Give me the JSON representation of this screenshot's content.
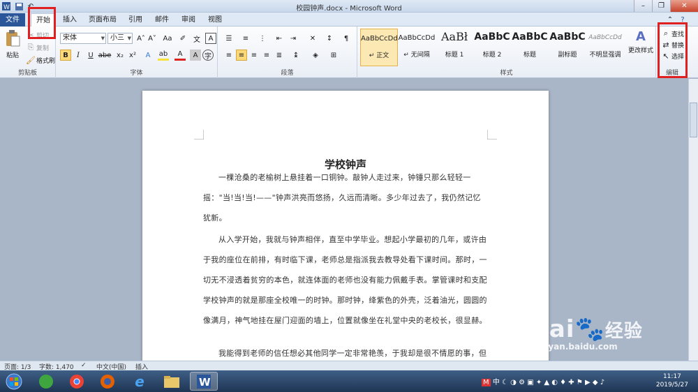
{
  "window": {
    "title": "校园钟声.docx - Microsoft Word"
  },
  "tabs": [
    {
      "label": "文件"
    },
    {
      "label": "开始"
    },
    {
      "label": "插入"
    },
    {
      "label": "页面布局"
    },
    {
      "label": "引用"
    },
    {
      "label": "邮件"
    },
    {
      "label": "审阅"
    },
    {
      "label": "视图"
    }
  ],
  "clipboard": {
    "paste": "粘贴",
    "cut": "剪切",
    "copy": "复制",
    "format_painter": "格式刷",
    "group": "剪贴板"
  },
  "font": {
    "name": "宋体",
    "size": "小三",
    "group": "字体"
  },
  "paragraph": {
    "group": "段落"
  },
  "styles": {
    "group": "样式",
    "items": [
      {
        "sample": "AaBbCcDd",
        "name": "↵ 正文"
      },
      {
        "sample": "AaBbCcDd",
        "name": "↵ 无间隔"
      },
      {
        "sample": "AaBł",
        "name": "标题 1"
      },
      {
        "sample": "AaBbC",
        "name": "标题 2"
      },
      {
        "sample": "AaBbC",
        "name": "标题"
      },
      {
        "sample": "AaBbC",
        "name": "副标题"
      },
      {
        "sample": "AaBbCcDd",
        "name": "不明显强调"
      }
    ],
    "change": "更改样式"
  },
  "editing": {
    "find": "查找",
    "replace": "替换",
    "select": "选择",
    "group": "编辑"
  },
  "document": {
    "title": "学校钟声",
    "paragraphs": [
      "一棵沧桑的老榆树上悬挂着一口铜钟。敲钟人走过来，钟锤只那么轻轻一摇：\"当!当!当!——\"钟声洪亮而悠扬，久远而清晰。多少年过去了，我仍然记忆犹新。",
      "从入学开始，我就与钟声相伴，直至中学毕业。想起小学最初的几年，或许由于我的座位在前排，有时临下课，老师总是指派我去教导处看下课时间。那时，一切无不浸透着贫穷的本色，就连体面的老师也没有能力佩戴手表。掌管课时和支配学校钟声的就是那座全校唯一的时钟。那时钟，绛紫色的外壳，泛着油光，圆圆的像满月，神气地挂在屋门迎面的墙上，位置就像坐在礼堂中央的老校长，很显赫。",
      "我能得到老师的信任想必其他同学一定非常艳羡，于我却是很不情愿的事，但为了完成老师交给的任务，每次都不会含糊。"
    ]
  },
  "status": {
    "page": "页面: 1/3",
    "words": "字数: 1,470",
    "language": "中文(中国)",
    "mode": "插入"
  },
  "taskbar": {
    "time": "11:17",
    "date": "2019/5/27",
    "ime": "中"
  },
  "watermark": {
    "brand": "Bai",
    "brand2": "经验",
    "url": "jingyan.baidu.com"
  },
  "colors": {
    "file_tab": "#2b579a",
    "highlight_red": "#e02020",
    "ribbon_bg": "#f3f6fa"
  }
}
